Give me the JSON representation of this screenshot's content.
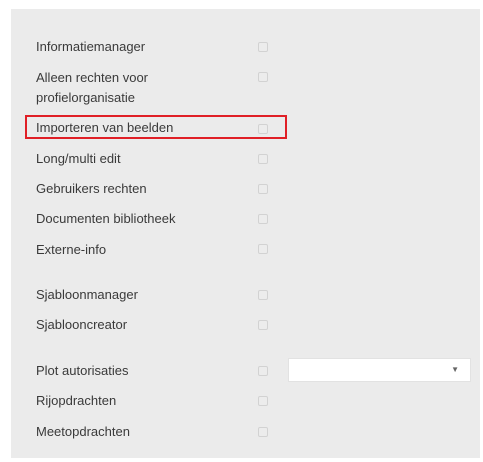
{
  "permissions": {
    "items": [
      {
        "label": "Informatiemanager",
        "checked": false
      },
      {
        "label": "Alleen rechten voor profielorganisatie",
        "checked": false
      },
      {
        "label": "Importeren van beelden",
        "checked": false,
        "highlighted": true
      },
      {
        "label": "Long/multi edit",
        "checked": false
      },
      {
        "label": "Gebruikers rechten",
        "checked": false
      },
      {
        "label": "Documenten bibliotheek",
        "checked": false
      },
      {
        "label": "Externe-info",
        "checked": false
      },
      {
        "label": "Sjabloonmanager",
        "checked": false
      },
      {
        "label": "Sjablooncreator",
        "checked": false
      },
      {
        "label": "Plot autorisaties",
        "checked": false
      },
      {
        "label": "Rijopdrachten",
        "checked": false
      },
      {
        "label": "Meetopdrachten",
        "checked": false
      }
    ]
  },
  "plot_select": {
    "value": ""
  },
  "icons": {
    "dropdown": "chevron-down-icon"
  },
  "colors": {
    "panel_background": "#ebebeb",
    "highlight_border": "#e01f26",
    "label_text": "#3a3a3a"
  }
}
